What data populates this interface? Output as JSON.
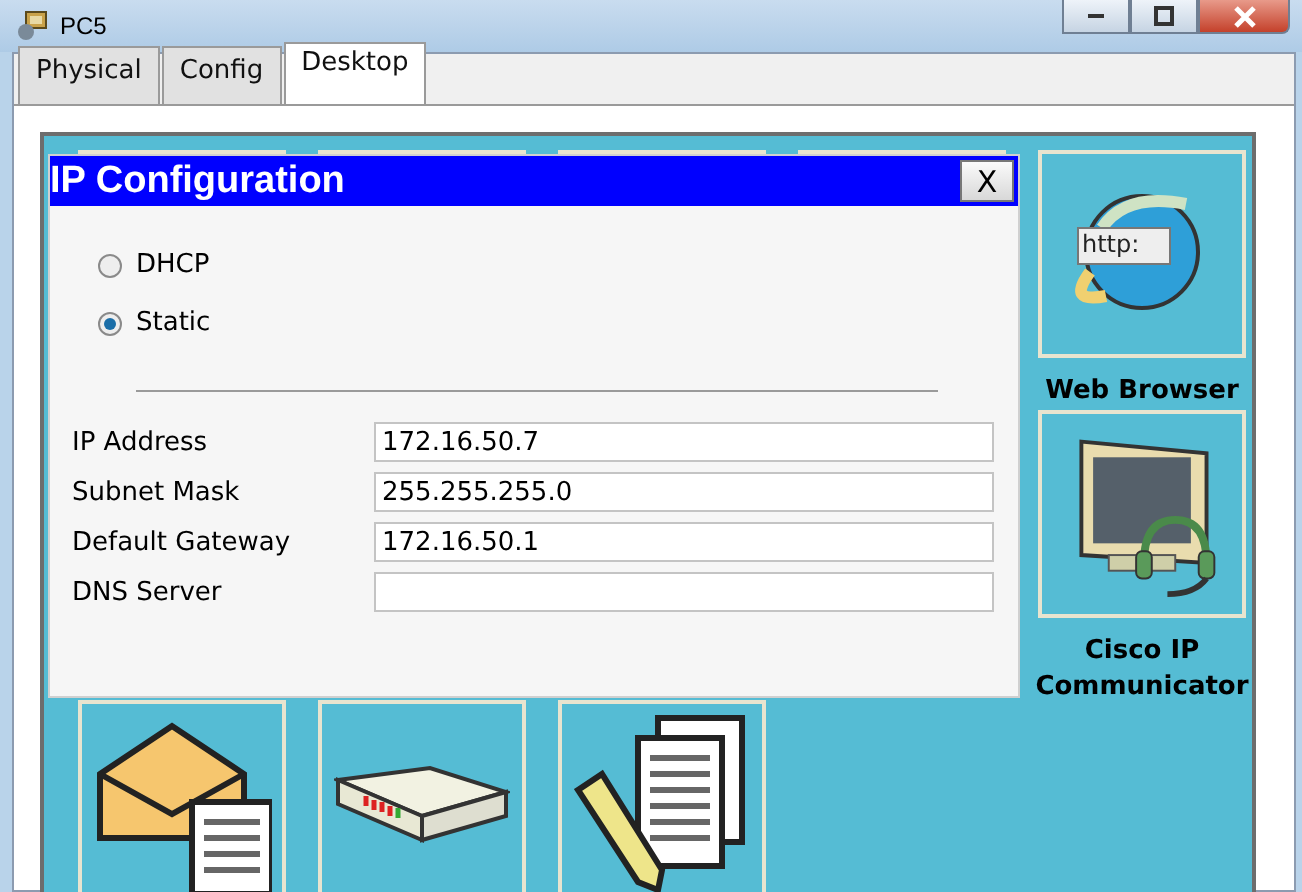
{
  "window": {
    "title": "PC5"
  },
  "tabs": [
    {
      "label": "Physical",
      "selected": false
    },
    {
      "label": "Config",
      "selected": false
    },
    {
      "label": "Desktop",
      "selected": true
    }
  ],
  "desktop": {
    "rows": [
      [
        {
          "kind": "covered"
        },
        {
          "kind": "covered"
        },
        {
          "kind": "covered"
        },
        {
          "kind": "covered"
        },
        {
          "kind": "browser",
          "icon_text": "http:",
          "label": "Web Browser"
        }
      ],
      [
        {
          "kind": "empty"
        },
        {
          "kind": "empty"
        },
        {
          "kind": "empty"
        },
        {
          "kind": "empty"
        },
        {
          "kind": "communicator",
          "label": "Cisco IP Communicator"
        }
      ],
      [
        {
          "kind": "email"
        },
        {
          "kind": "server"
        },
        {
          "kind": "editor"
        }
      ]
    ]
  },
  "dialog": {
    "title": "IP Configuration",
    "close": "X",
    "modes": [
      {
        "label": "DHCP",
        "selected": false
      },
      {
        "label": "Static",
        "selected": true
      }
    ],
    "fields": [
      {
        "label": "IP Address",
        "value": "172.16.50.7"
      },
      {
        "label": "Subnet Mask",
        "value": "255.255.255.0"
      },
      {
        "label": "Default Gateway",
        "value": "172.16.50.1"
      },
      {
        "label": "DNS Server"
      }
    ]
  }
}
